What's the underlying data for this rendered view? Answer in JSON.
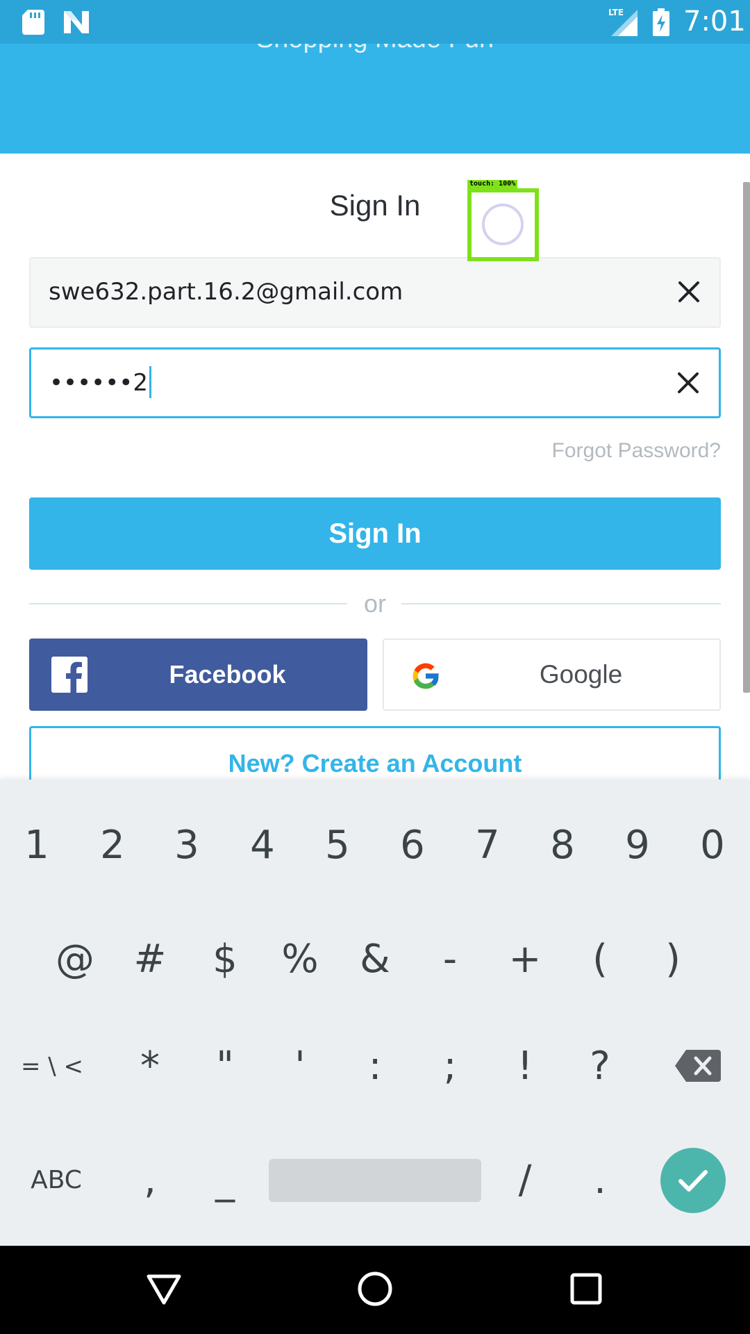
{
  "status_bar": {
    "time": "7:01",
    "network": "LTE",
    "icons": [
      "sd-card-icon",
      "n-notification-icon",
      "lte-signal-icon",
      "battery-charging-icon"
    ]
  },
  "header": {
    "tagline": "Shopping Made Fun",
    "color": "#33b5e9"
  },
  "signin": {
    "title": "Sign In",
    "email_value": "swe632.part.16.2@gmail.com",
    "password_value": "••••••2",
    "forgot_label": "Forgot Password?",
    "signin_button": "Sign In",
    "or_label": "or",
    "facebook_button": "Facebook",
    "google_button": "Google",
    "create_account_button": "New? Create an Account"
  },
  "touch_overlay": {
    "label": "touch: 100%"
  },
  "keyboard": {
    "row1": [
      "1",
      "2",
      "3",
      "4",
      "5",
      "6",
      "7",
      "8",
      "9",
      "0"
    ],
    "row2": [
      "@",
      "#",
      "$",
      "%",
      "&",
      "-",
      "+",
      "(",
      ")"
    ],
    "row3": [
      "= \\ <",
      "*",
      "\"",
      "'",
      ":",
      ";",
      "!",
      "?"
    ],
    "row4": [
      "ABC",
      ",",
      "_",
      "/",
      "."
    ],
    "icons": [
      "backspace-icon",
      "enter-check-icon"
    ]
  },
  "nav_bar": {
    "icons": [
      "back-icon",
      "home-icon",
      "recents-icon"
    ]
  },
  "colors": {
    "accent": "#33b5e9",
    "facebook": "#405b9e",
    "enter_key": "#4db6ac"
  }
}
